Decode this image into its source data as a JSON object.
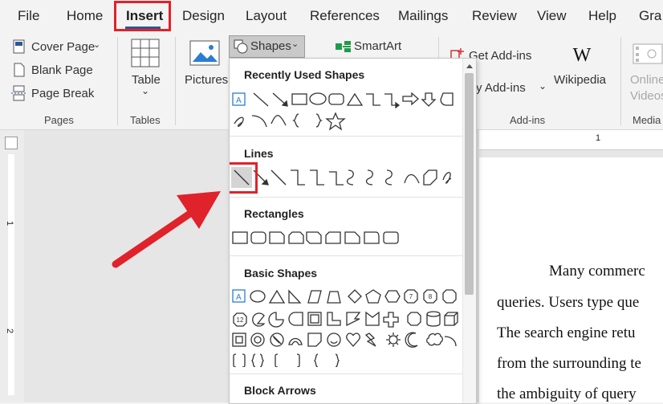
{
  "menubar": {
    "tabs": [
      "File",
      "Home",
      "Insert",
      "Design",
      "Layout",
      "References",
      "Mailings",
      "Review",
      "View",
      "Help",
      "Gra"
    ],
    "active": "Insert"
  },
  "ribbon": {
    "pages": {
      "cover_page": "Cover Page",
      "blank_page": "Blank Page",
      "page_break": "Page Break",
      "label": "Pages"
    },
    "tables": {
      "table": "Table",
      "label": "Tables"
    },
    "pictures": "Pictures",
    "shapes": "Shapes",
    "smartart": "SmartArt",
    "get_addins": "Get Add-ins",
    "my_addins": "y Add-ins",
    "wikipedia": "Wikipedia",
    "addins_label": "Add-ins",
    "online_videos_1": "Online",
    "online_videos_2": "Videos",
    "media_label": "Media"
  },
  "ruler": {
    "num1": "1",
    "num2": "2",
    "top1": "1"
  },
  "dropdown": {
    "sections": [
      "Recently Used Shapes",
      "Lines",
      "Rectangles",
      "Basic Shapes",
      "Block Arrows"
    ],
    "octagon_8": "8",
    "hept_7": "7",
    "dodec_12": "12",
    "text_a": "A"
  },
  "document": {
    "lines": [
      "Many commerc",
      "queries. Users type que",
      "The search engine retu",
      "from the surrounding te",
      "the ambiguity of query"
    ]
  },
  "colors": {
    "highlight": "#e0222a",
    "accent": "#2b579a",
    "arrow": "#e0222a"
  }
}
